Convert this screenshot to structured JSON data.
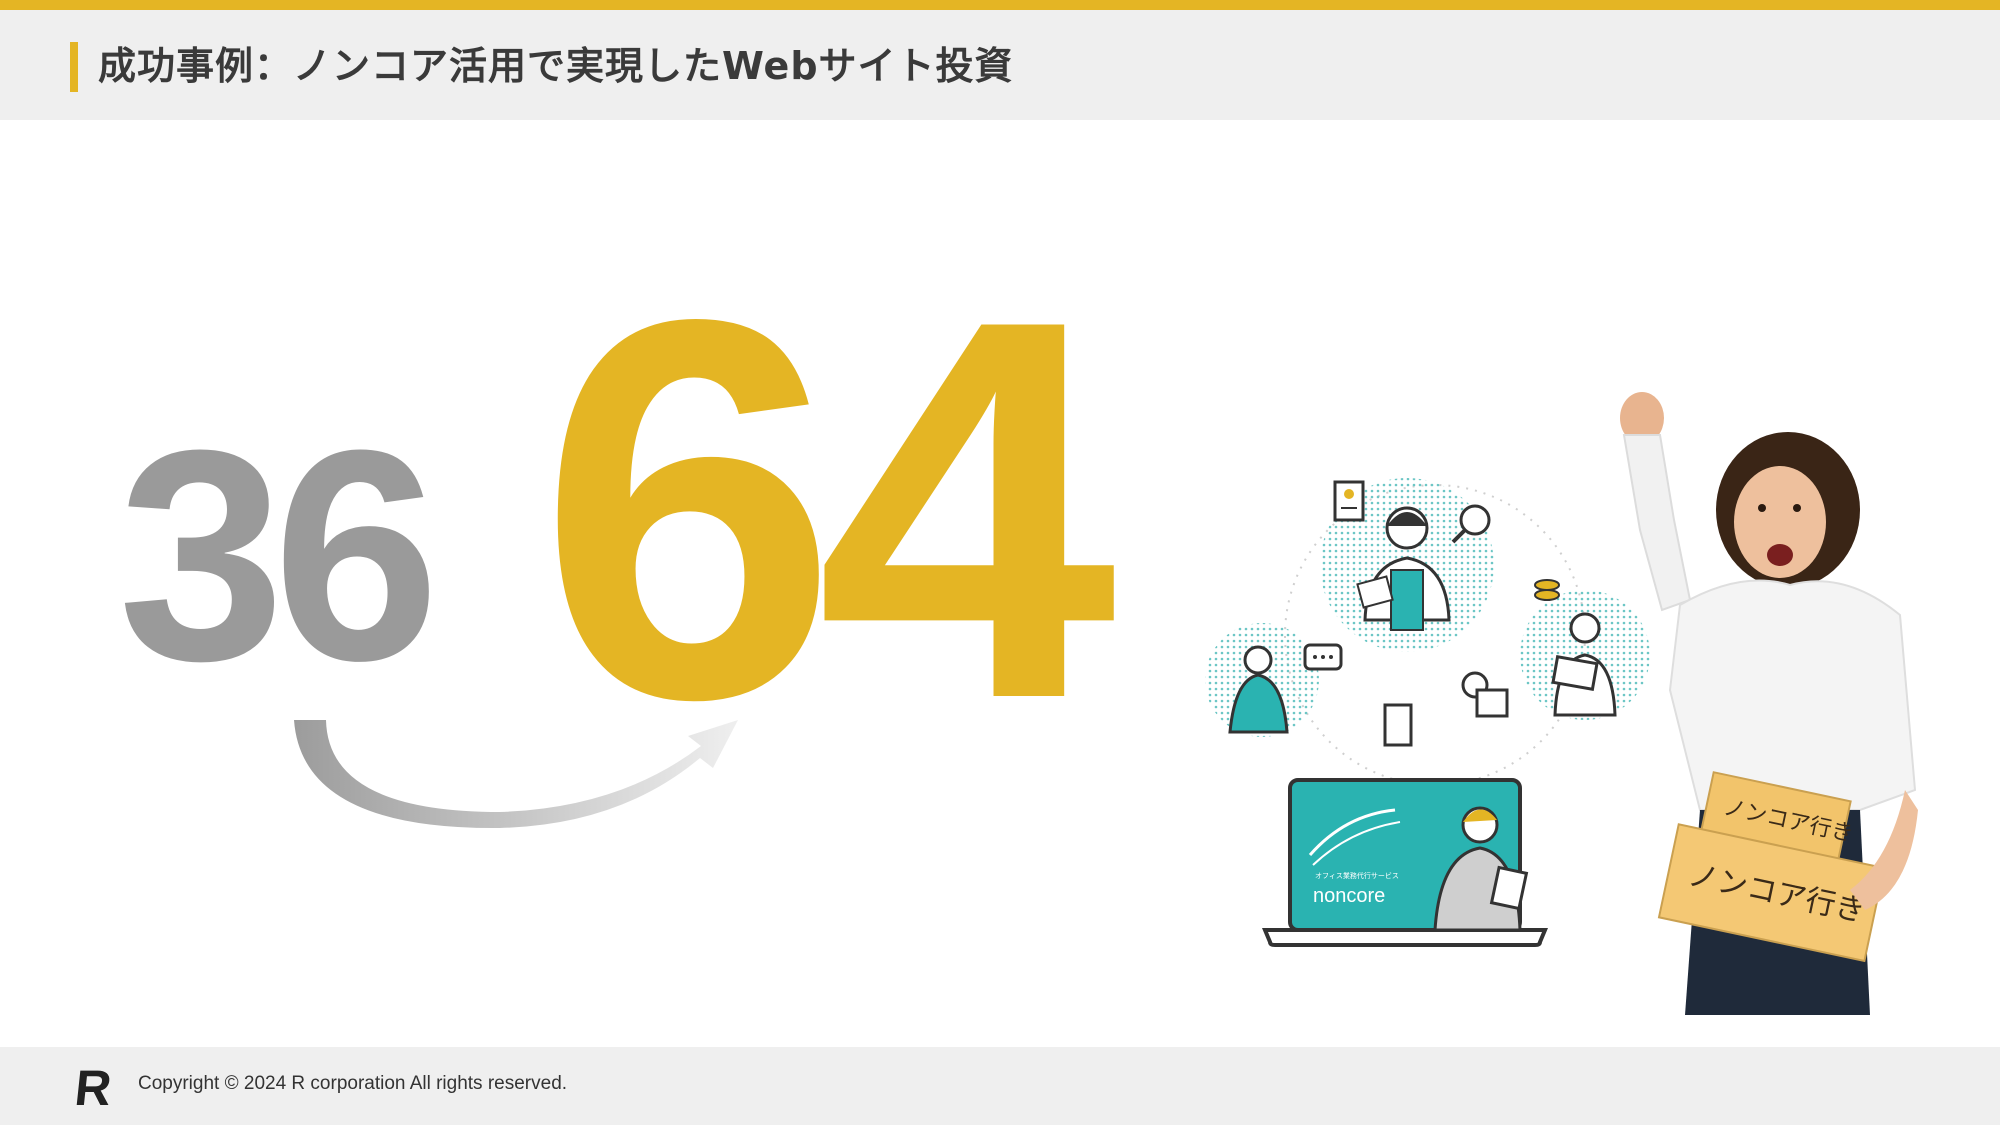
{
  "header": {
    "title": "成功事例：ノンコア活用で実現したWebサイト投資"
  },
  "metrics": {
    "before": "36",
    "after": "64"
  },
  "laptop": {
    "brand_caption": "オフィス業務代行サービス",
    "brand_name": "noncore"
  },
  "boxes": {
    "small_label": "ノンコア行き",
    "large_label": "ノンコア行き"
  },
  "footer": {
    "copyright": "Copyright © 2024 R corporation All rights reserved.",
    "logo_letter": "R"
  },
  "colors": {
    "accent": "#e4b524",
    "gray": "#9a9a9a",
    "teal": "#2ab3b1",
    "header_bg": "#efefef"
  }
}
